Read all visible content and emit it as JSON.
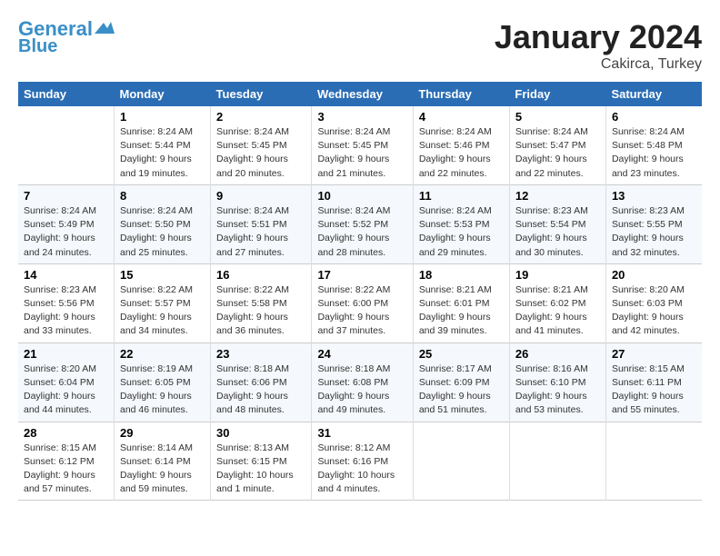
{
  "header": {
    "logo_line1": "General",
    "logo_line2": "Blue",
    "month": "January 2024",
    "location": "Cakirca, Turkey"
  },
  "weekdays": [
    "Sunday",
    "Monday",
    "Tuesday",
    "Wednesday",
    "Thursday",
    "Friday",
    "Saturday"
  ],
  "weeks": [
    [
      {
        "day": "",
        "info": ""
      },
      {
        "day": "1",
        "info": "Sunrise: 8:24 AM\nSunset: 5:44 PM\nDaylight: 9 hours\nand 19 minutes."
      },
      {
        "day": "2",
        "info": "Sunrise: 8:24 AM\nSunset: 5:45 PM\nDaylight: 9 hours\nand 20 minutes."
      },
      {
        "day": "3",
        "info": "Sunrise: 8:24 AM\nSunset: 5:45 PM\nDaylight: 9 hours\nand 21 minutes."
      },
      {
        "day": "4",
        "info": "Sunrise: 8:24 AM\nSunset: 5:46 PM\nDaylight: 9 hours\nand 22 minutes."
      },
      {
        "day": "5",
        "info": "Sunrise: 8:24 AM\nSunset: 5:47 PM\nDaylight: 9 hours\nand 22 minutes."
      },
      {
        "day": "6",
        "info": "Sunrise: 8:24 AM\nSunset: 5:48 PM\nDaylight: 9 hours\nand 23 minutes."
      }
    ],
    [
      {
        "day": "7",
        "info": ""
      },
      {
        "day": "8",
        "info": "Sunrise: 8:24 AM\nSunset: 5:50 PM\nDaylight: 9 hours\nand 25 minutes."
      },
      {
        "day": "9",
        "info": "Sunrise: 8:24 AM\nSunset: 5:51 PM\nDaylight: 9 hours\nand 27 minutes."
      },
      {
        "day": "10",
        "info": "Sunrise: 8:24 AM\nSunset: 5:52 PM\nDaylight: 9 hours\nand 28 minutes."
      },
      {
        "day": "11",
        "info": "Sunrise: 8:24 AM\nSunset: 5:53 PM\nDaylight: 9 hours\nand 29 minutes."
      },
      {
        "day": "12",
        "info": "Sunrise: 8:23 AM\nSunset: 5:54 PM\nDaylight: 9 hours\nand 30 minutes."
      },
      {
        "day": "13",
        "info": "Sunrise: 8:23 AM\nSunset: 5:55 PM\nDaylight: 9 hours\nand 32 minutes."
      }
    ],
    [
      {
        "day": "14",
        "info": "Sunrise: 8:23 AM\nSunset: 5:56 PM\nDaylight: 9 hours\nand 33 minutes."
      },
      {
        "day": "15",
        "info": "Sunrise: 8:22 AM\nSunset: 5:57 PM\nDaylight: 9 hours\nand 34 minutes."
      },
      {
        "day": "16",
        "info": "Sunrise: 8:22 AM\nSunset: 5:58 PM\nDaylight: 9 hours\nand 36 minutes."
      },
      {
        "day": "17",
        "info": "Sunrise: 8:22 AM\nSunset: 6:00 PM\nDaylight: 9 hours\nand 37 minutes."
      },
      {
        "day": "18",
        "info": "Sunrise: 8:21 AM\nSunset: 6:01 PM\nDaylight: 9 hours\nand 39 minutes."
      },
      {
        "day": "19",
        "info": "Sunrise: 8:21 AM\nSunset: 6:02 PM\nDaylight: 9 hours\nand 41 minutes."
      },
      {
        "day": "20",
        "info": "Sunrise: 8:20 AM\nSunset: 6:03 PM\nDaylight: 9 hours\nand 42 minutes."
      }
    ],
    [
      {
        "day": "21",
        "info": "Sunrise: 8:20 AM\nSunset: 6:04 PM\nDaylight: 9 hours\nand 44 minutes."
      },
      {
        "day": "22",
        "info": "Sunrise: 8:19 AM\nSunset: 6:05 PM\nDaylight: 9 hours\nand 46 minutes."
      },
      {
        "day": "23",
        "info": "Sunrise: 8:18 AM\nSunset: 6:06 PM\nDaylight: 9 hours\nand 48 minutes."
      },
      {
        "day": "24",
        "info": "Sunrise: 8:18 AM\nSunset: 6:08 PM\nDaylight: 9 hours\nand 49 minutes."
      },
      {
        "day": "25",
        "info": "Sunrise: 8:17 AM\nSunset: 6:09 PM\nDaylight: 9 hours\nand 51 minutes."
      },
      {
        "day": "26",
        "info": "Sunrise: 8:16 AM\nSunset: 6:10 PM\nDaylight: 9 hours\nand 53 minutes."
      },
      {
        "day": "27",
        "info": "Sunrise: 8:15 AM\nSunset: 6:11 PM\nDaylight: 9 hours\nand 55 minutes."
      }
    ],
    [
      {
        "day": "28",
        "info": "Sunrise: 8:15 AM\nSunset: 6:12 PM\nDaylight: 9 hours\nand 57 minutes."
      },
      {
        "day": "29",
        "info": "Sunrise: 8:14 AM\nSunset: 6:14 PM\nDaylight: 9 hours\nand 59 minutes."
      },
      {
        "day": "30",
        "info": "Sunrise: 8:13 AM\nSunset: 6:15 PM\nDaylight: 10 hours\nand 1 minute."
      },
      {
        "day": "31",
        "info": "Sunrise: 8:12 AM\nSunset: 6:16 PM\nDaylight: 10 hours\nand 4 minutes."
      },
      {
        "day": "",
        "info": ""
      },
      {
        "day": "",
        "info": ""
      },
      {
        "day": "",
        "info": ""
      }
    ]
  ]
}
